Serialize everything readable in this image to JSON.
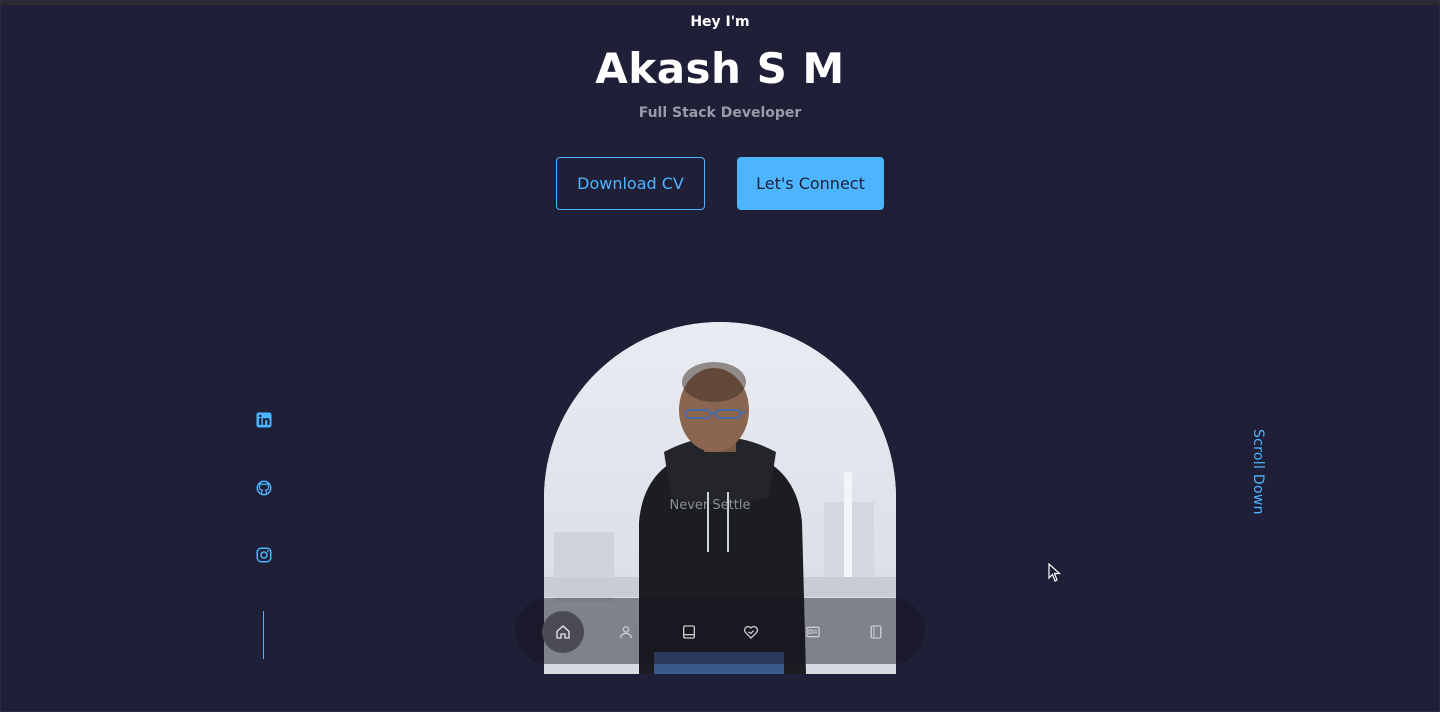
{
  "hero": {
    "greeting": "Hey I'm",
    "name": "Akash S M",
    "role": "Full Stack Developer"
  },
  "buttons": {
    "download_cv": "Download CV",
    "connect": "Let's Connect"
  },
  "socials": [
    {
      "icon": "linkedin-icon"
    },
    {
      "icon": "github-icon"
    },
    {
      "icon": "instagram-icon"
    }
  ],
  "scroll_label": "Scroll Down",
  "photo": {
    "shirt_text": "Never Settle"
  },
  "nav": [
    {
      "icon": "home-icon",
      "active": true
    },
    {
      "icon": "user-icon",
      "active": false
    },
    {
      "icon": "book-icon",
      "active": false
    },
    {
      "icon": "services-icon",
      "active": false
    },
    {
      "icon": "portfolio-icon",
      "active": false
    },
    {
      "icon": "contact-icon",
      "active": false
    }
  ],
  "colors": {
    "background": "#1f1f38",
    "accent": "#4db5ff",
    "muted_text": "#9a9aa8"
  }
}
